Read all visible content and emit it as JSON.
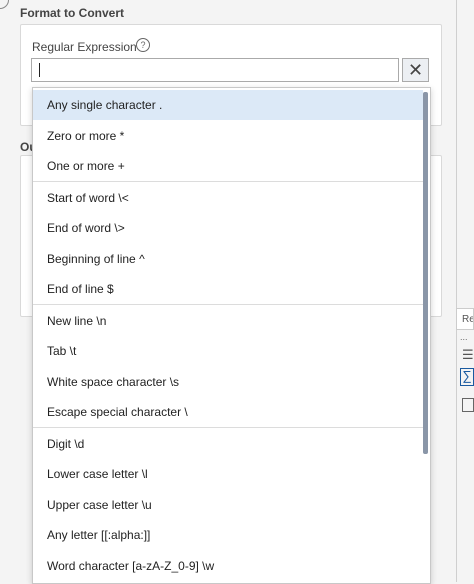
{
  "section": {
    "title": "Format to Convert",
    "output_label": "Ou"
  },
  "regex": {
    "label": "Regular Expression",
    "help": "?",
    "value": "",
    "clear": "✕"
  },
  "right_panel": {
    "tab_label": "Re",
    "dots": "...",
    "sum_icon": "∑",
    "table_icon": "☰"
  },
  "dropdown": {
    "items": [
      {
        "label": "Any single character  ."
      },
      {
        "label": "Zero or more  *"
      },
      {
        "label": "One or more  +"
      },
      {
        "label": "Start of word  \\<"
      },
      {
        "label": "End of word  \\>"
      },
      {
        "label": "Beginning of line  ^"
      },
      {
        "label": "End of line  $"
      },
      {
        "label": "New line  \\n"
      },
      {
        "label": "Tab  \\t"
      },
      {
        "label": "White space character  \\s"
      },
      {
        "label": "Escape special character  \\"
      },
      {
        "label": "Digit  \\d"
      },
      {
        "label": "Lower case letter  \\l"
      },
      {
        "label": "Upper case letter  \\u"
      },
      {
        "label": "Any letter  [[:alpha:]]"
      },
      {
        "label": "Word character  [a-zA-Z_0-9]  \\w"
      }
    ]
  }
}
